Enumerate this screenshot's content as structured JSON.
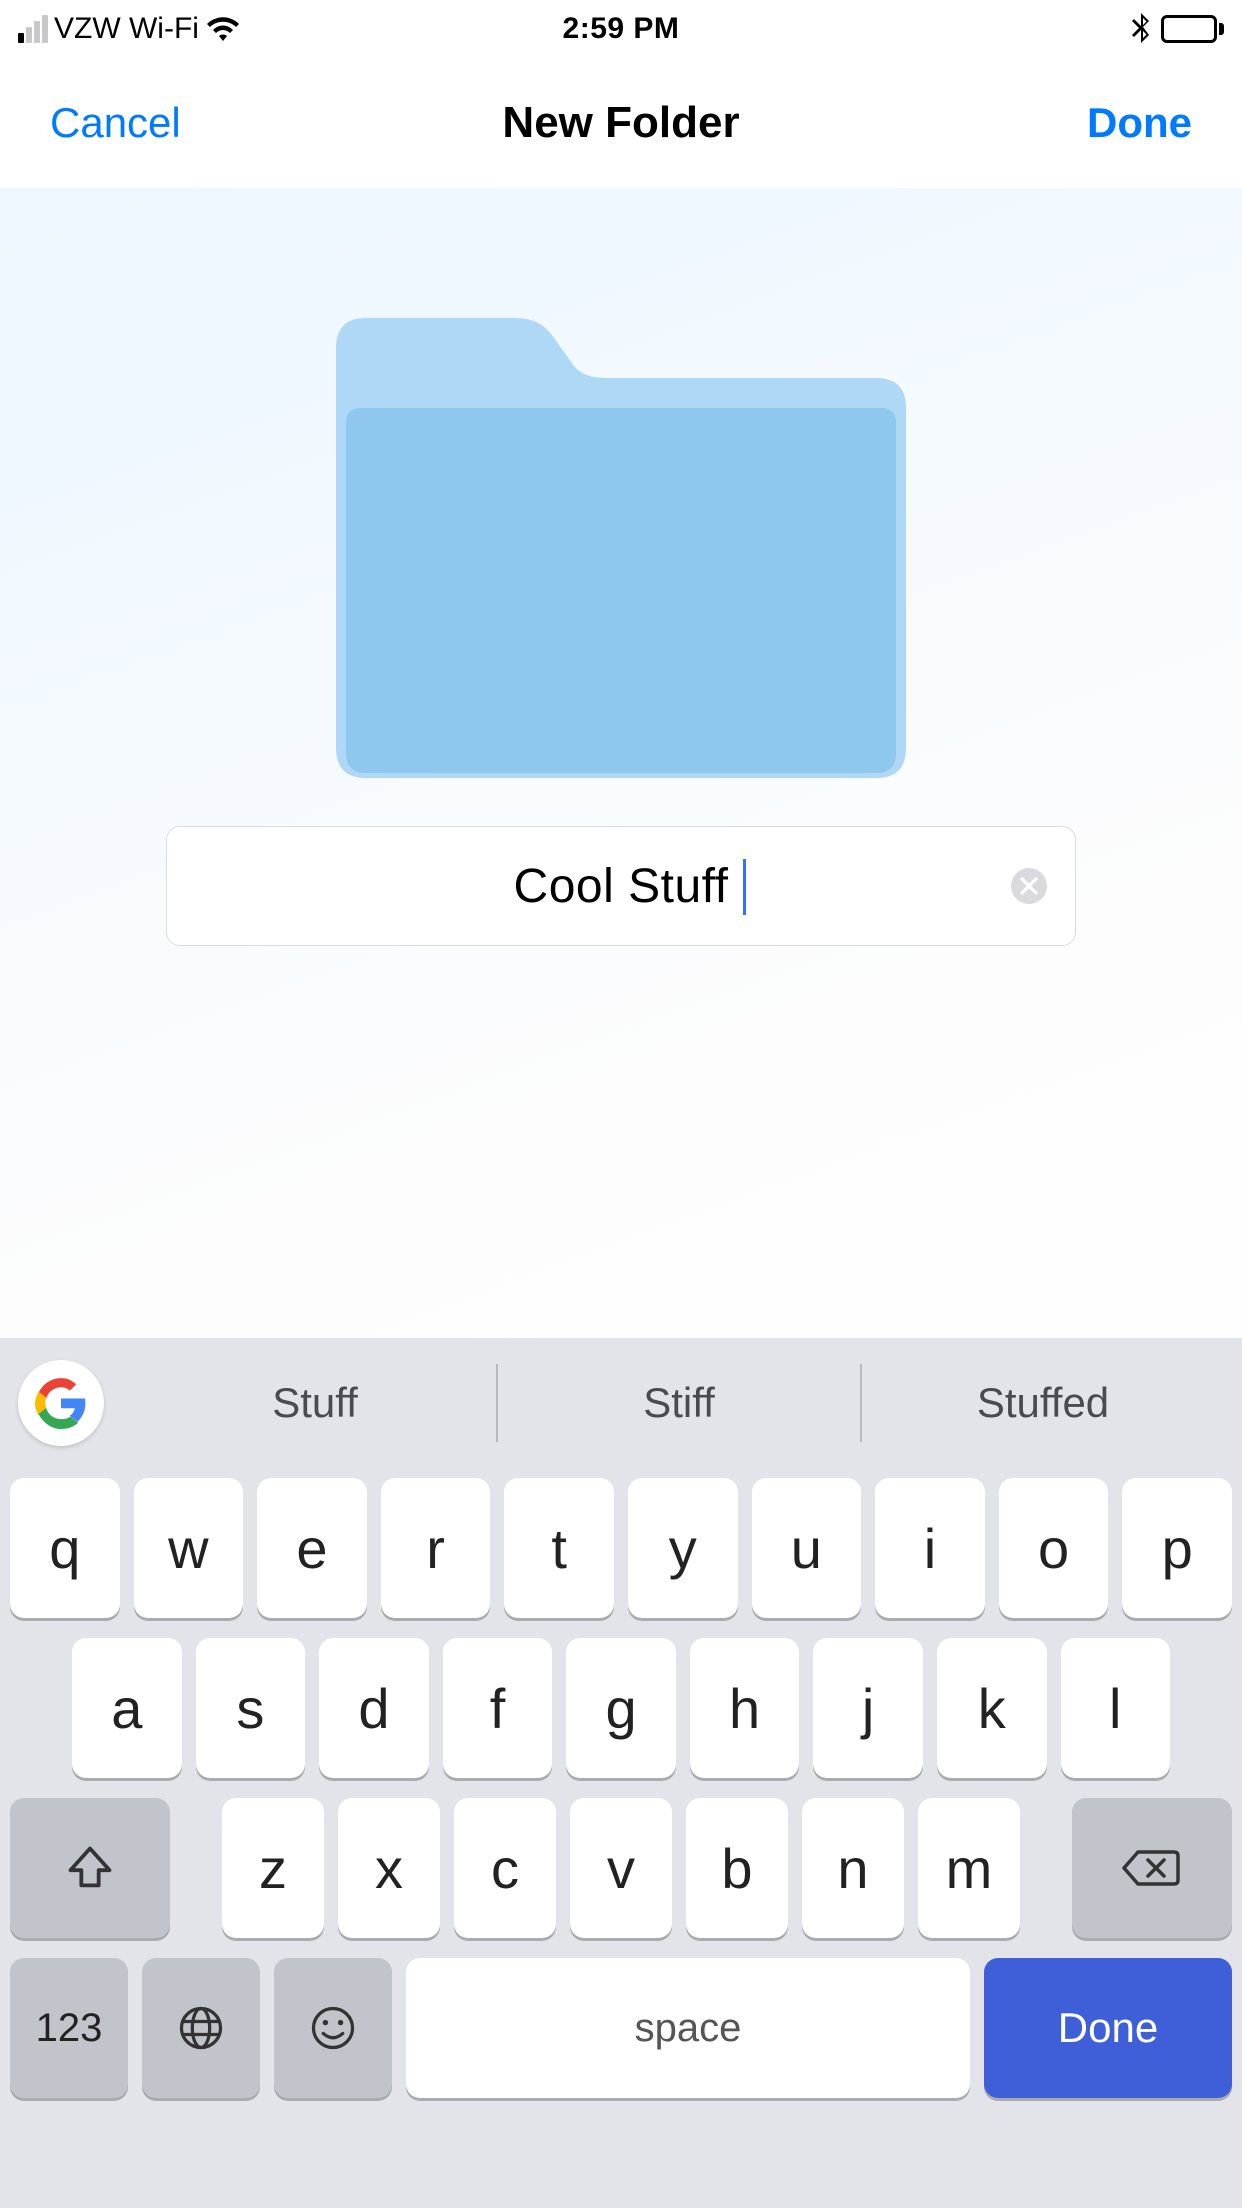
{
  "statusBar": {
    "carrier": "VZW Wi-Fi",
    "time": "2:59 PM"
  },
  "nav": {
    "cancel": "Cancel",
    "title": "New Folder",
    "done": "Done"
  },
  "folderName": {
    "value": "Cool Stuff"
  },
  "keyboard": {
    "suggestions": [
      "Stuff",
      "Stiff",
      "Stuffed"
    ],
    "row1": [
      "q",
      "w",
      "e",
      "r",
      "t",
      "y",
      "u",
      "i",
      "o",
      "p"
    ],
    "row2": [
      "a",
      "s",
      "d",
      "f",
      "g",
      "h",
      "j",
      "k",
      "l"
    ],
    "row3": [
      "z",
      "x",
      "c",
      "v",
      "b",
      "n",
      "m"
    ],
    "numKey": "123",
    "space": "space",
    "done": "Done"
  }
}
